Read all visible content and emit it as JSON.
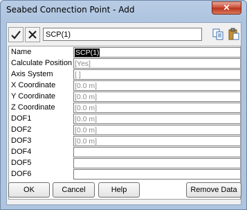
{
  "window": {
    "title": "Seabed Connection Point - Add",
    "close_label": "✕"
  },
  "toolbar": {
    "name_value": "SCP(1)"
  },
  "properties": [
    {
      "label": "Name",
      "value": "SCP(1)",
      "state": "selected"
    },
    {
      "label": "Calculate Position",
      "value": "[Yes]",
      "state": "normal"
    },
    {
      "label": "Axis System",
      "value": "[ ]",
      "state": "normal"
    },
    {
      "label": "X Coordinate",
      "value": "[0.0 m]",
      "state": "normal"
    },
    {
      "label": "Y Coordinate",
      "value": "[0.0 m]",
      "state": "normal"
    },
    {
      "label": "Z Coordinate",
      "value": "[0.0 m]",
      "state": "normal"
    },
    {
      "label": "DOF1",
      "value": "[0.0 m]",
      "state": "normal"
    },
    {
      "label": "DOF2",
      "value": "[0.0 m]",
      "state": "normal"
    },
    {
      "label": "DOF3",
      "value": "[0.0 m]",
      "state": "normal"
    },
    {
      "label": "DOF4",
      "value": "",
      "state": "empty"
    },
    {
      "label": "DOF5",
      "value": "",
      "state": "empty"
    },
    {
      "label": "DOF6",
      "value": "",
      "state": "empty"
    }
  ],
  "buttons": {
    "ok": "OK",
    "cancel": "Cancel",
    "help": "Help",
    "remove": "Remove Data"
  }
}
